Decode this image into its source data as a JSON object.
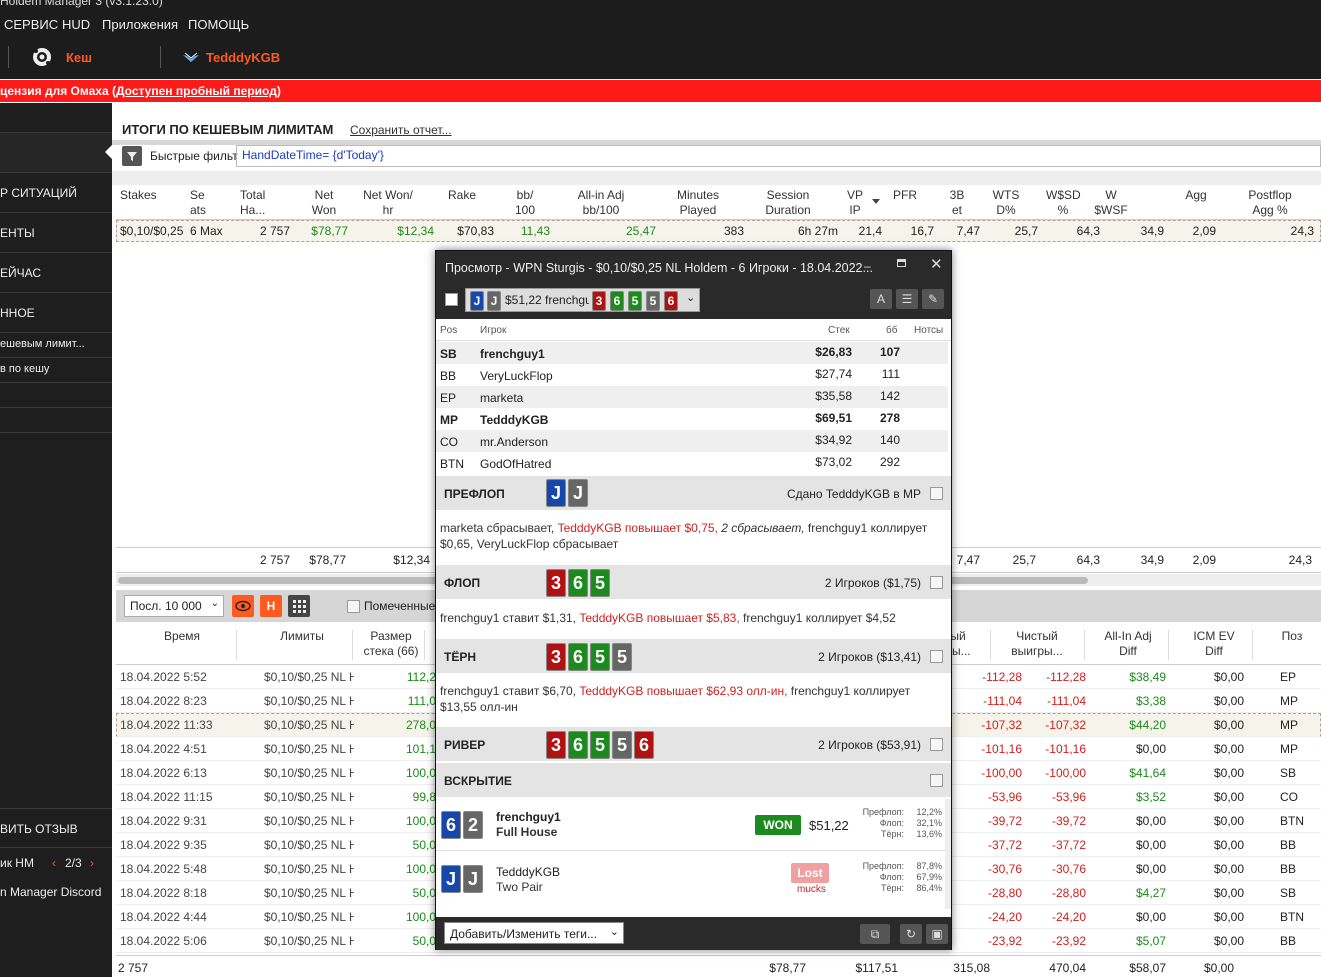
{
  "app": {
    "title": "Holdem Manager 3 (v3.1.23.0)",
    "menus": [
      "СЕРВИС",
      "HUD",
      "Приложения",
      "ПОМОЩЬ"
    ],
    "cash_label": "Кеш",
    "player_label": "TedddyKGB"
  },
  "banner": {
    "text": "цензия для Омаха (",
    "link": "Доступен пробный период",
    "end": ")"
  },
  "nav": {
    "items": [
      "Р СИТУАЦИЙ",
      "ЕНТЫ",
      "ЕЙЧАС",
      "ННОЕ",
      "ешевым лимит...",
      "в по кешу"
    ],
    "feedback": "ВИТЬ ОТЗЫВ",
    "tips": "ик HM",
    "tips_page": "2/3",
    "discord": "n Manager Discord"
  },
  "report": {
    "title": "ИТОГИ ПО КЕШЕВЫМ ЛИМИТАМ",
    "save": "Сохранить отчет...",
    "filter_label": "Быстрые фильт",
    "filter_value": "HandDateTime= {d'Today'}"
  },
  "summary": {
    "headers": [
      "Stakes",
      "Se\nats",
      "Total\nHa...",
      "Net\nWon",
      "Net Won/\nhr",
      "Rake",
      "bb/\n100",
      "All-in Adj\nbb/100",
      "Minutes\nPlayed",
      "Session\nDuration",
      "VP\nIP",
      "PFR",
      "3B\net",
      "WTS\nD%",
      "W$SD\n%",
      "W\n$WSF",
      "Agg",
      "Postflop\nAgg %"
    ],
    "row": [
      "$0,10/$0,25",
      "6 Max",
      "2 757",
      "$78,77",
      "$12,34",
      "$70,83",
      "11,43",
      "25,47",
      "383",
      "6h 27m",
      "21,4",
      "16,7",
      "7,47",
      "25,7",
      "64,3",
      "34,9",
      "2,09",
      "24,3"
    ],
    "totals": [
      "2 757",
      "$78,77",
      "$12,34",
      "7,47",
      "25,7",
      "64,3",
      "34,9",
      "2,09",
      "24,3"
    ]
  },
  "hands": {
    "filter": "Посл. 10 000",
    "marked": "Помеченные",
    "headers": [
      "Время",
      "Лимиты",
      "Размер\nстека (66)",
      "ый\nны...",
      "Чистый\nвыигры...",
      "All-In Adj\nDiff",
      "ICM EV\nDiff",
      "Поз"
    ],
    "rows": [
      [
        "18.04.2022 5:52",
        "$0,10/$0,25 NL H",
        "112,2",
        "-112,28",
        "-112,28",
        "$38,49",
        "$0,00",
        "EP"
      ],
      [
        "18.04.2022 8:23",
        "$0,10/$0,25 NL H",
        "111,0",
        "-111,04",
        "-111,04",
        "$3,38",
        "$0,00",
        "MP"
      ],
      [
        "18.04.2022 11:33",
        "$0,10/$0,25 NL H",
        "278,0",
        "-107,32",
        "-107,32",
        "$44,20",
        "$0,00",
        "MP"
      ],
      [
        "18.04.2022 4:51",
        "$0,10/$0,25 NL H",
        "101,1",
        "-101,16",
        "-101,16",
        "$0,00",
        "$0,00",
        "MP"
      ],
      [
        "18.04.2022 6:13",
        "$0,10/$0,25 NL H",
        "100,0",
        "-100,00",
        "-100,00",
        "$41,64",
        "$0,00",
        "SB"
      ],
      [
        "18.04.2022 11:15",
        "$0,10/$0,25 NL H",
        "99,8",
        "-53,96",
        "-53,96",
        "$3,52",
        "$0,00",
        "CO"
      ],
      [
        "18.04.2022 9:31",
        "$0,10/$0,25 NL H",
        "100,0",
        "-39,72",
        "-39,72",
        "$0,00",
        "$0,00",
        "BTN"
      ],
      [
        "18.04.2022 9:35",
        "$0,10/$0,25 NL H",
        "50,0",
        "-37,72",
        "-37,72",
        "$0,00",
        "$0,00",
        "BB"
      ],
      [
        "18.04.2022 5:48",
        "$0,10/$0,25 NL H",
        "100,0",
        "-30,76",
        "-30,76",
        "$0,00",
        "$0,00",
        "BB"
      ],
      [
        "18.04.2022 8:18",
        "$0,10/$0,25 NL H",
        "50,0",
        "-28,80",
        "-28,80",
        "$4,27",
        "$0,00",
        "SB"
      ],
      [
        "18.04.2022 4:44",
        "$0,10/$0,25 NL H",
        "100,0",
        "-24,20",
        "-24,20",
        "$0,00",
        "$0,00",
        "BTN"
      ],
      [
        "18.04.2022 5:06",
        "$0,10/$0,25 NL H",
        "50,0",
        "-23,92",
        "-23,92",
        "$5,07",
        "$0,00",
        "BB"
      ]
    ],
    "totals": [
      "2 757",
      "$78,77",
      "$117,51",
      "315,08",
      "470,04",
      "$58,07",
      "$0,00"
    ]
  },
  "popup": {
    "title": "Просмотр - WPN Sturgis - $0,10/$0,25 NL Holdem - 6 Игроки - 18.04.2022...",
    "hand_summary": "$51,22 frenchgu",
    "col_pos": "Pos",
    "col_player": "Игрок",
    "col_stack": "Стек",
    "col_bb": "бб",
    "col_notes": "Нотсы",
    "players": [
      {
        "pos": "SB",
        "name": "frenchguy1",
        "stack": "$26,83",
        "bb": "107"
      },
      {
        "pos": "BB",
        "name": "VeryLuckFlop",
        "stack": "$27,74",
        "bb": "111"
      },
      {
        "pos": "EP",
        "name": "marketa",
        "stack": "$35,58",
        "bb": "142"
      },
      {
        "pos": "MP",
        "name": "TedddyKGB",
        "stack": "$69,51",
        "bb": "278"
      },
      {
        "pos": "CO",
        "name": "mr.Anderson",
        "stack": "$34,92",
        "bb": "140"
      },
      {
        "pos": "BTN",
        "name": "GodOfHatred",
        "stack": "$73,02",
        "bb": "292"
      }
    ],
    "preflop": {
      "name": "ПРЕФЛОП",
      "right": "Сдано TedddyKGB в MP",
      "a1": "marketa сбрасывает, ",
      "a2": "TedddyKGB повышает $0,75,",
      "a3": " 2 сбрасывает,",
      "a4": " frenchguy1 коллирует $0,65, VeryLuckFlop сбрасывает"
    },
    "flop": {
      "name": "ФЛОП",
      "right": "2 Игроков ($1,75)",
      "a1": "frenchguy1 ставит $1,31, ",
      "a2": "TedddyKGB повышает $5,83,",
      "a3": " frenchguy1 коллирует $4,52"
    },
    "turn": {
      "name": "ТЁРН",
      "right": "2 Игроков ($13,41)",
      "a1": "frenchguy1 ставит $6,70, ",
      "a2": "TedddyKGB повышает $62,93 олл-ин,",
      "a3": " frenchguy1 коллирует $13,55 олл-ин"
    },
    "river": {
      "name": "РИВЕР",
      "right": "2 Игроков ($53,91)"
    },
    "showdown": {
      "name": "ВСКРЫТИЕ"
    },
    "sd1": {
      "name": "frenchguy1",
      "hand": "Full House",
      "badge": "WON",
      "amount": "$51,22",
      "l1": "Префлоп:",
      "v1": "12,2%",
      "l2": "Флоп:",
      "v2": "32,1%",
      "l3": "Тёрн:",
      "v3": "13,6%"
    },
    "sd2": {
      "name": "TedddyKGB",
      "hand": "Two Pair",
      "badge": "Lost",
      "sub": "mucks",
      "l1": "Префлоп:",
      "v1": "87,8%",
      "l2": "Флоп:",
      "v2": "67,9%",
      "l3": "Тёрн:",
      "v3": "86,4%"
    },
    "tags": "Добавить/Изменить теги...",
    "cards": {
      "hole": [
        "J",
        "J"
      ],
      "board": [
        "3",
        "6",
        "5",
        "5",
        "6"
      ],
      "sd1": [
        "6",
        "2"
      ],
      "sd2": [
        "J",
        "J"
      ]
    }
  },
  "colors": {
    "accent": "#ff5a1f",
    "banner": "#ff1a1a",
    "win": "#1b8a1b",
    "loss": "#d01f1f"
  }
}
